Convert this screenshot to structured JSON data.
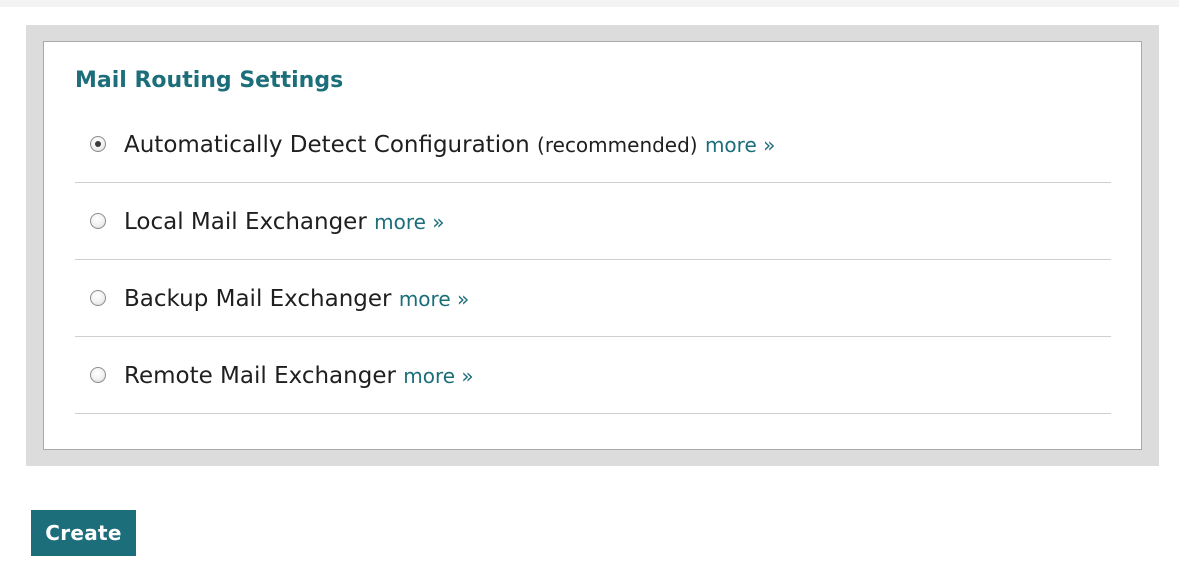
{
  "panel": {
    "title": "Mail Routing Settings",
    "options": [
      {
        "label": "Automatically Detect Configuration",
        "note": "(recommended)",
        "more": "more »",
        "selected": true
      },
      {
        "label": "Local Mail Exchanger",
        "note": "",
        "more": "more »",
        "selected": false
      },
      {
        "label": "Backup Mail Exchanger",
        "note": "",
        "more": "more »",
        "selected": false
      },
      {
        "label": "Remote Mail Exchanger",
        "note": "",
        "more": "more »",
        "selected": false
      }
    ]
  },
  "actions": {
    "create_label": "Create"
  },
  "colors": {
    "accent": "#1c6e7a",
    "panel_border": "#dcdcdc",
    "divider": "#cfcfcf"
  }
}
